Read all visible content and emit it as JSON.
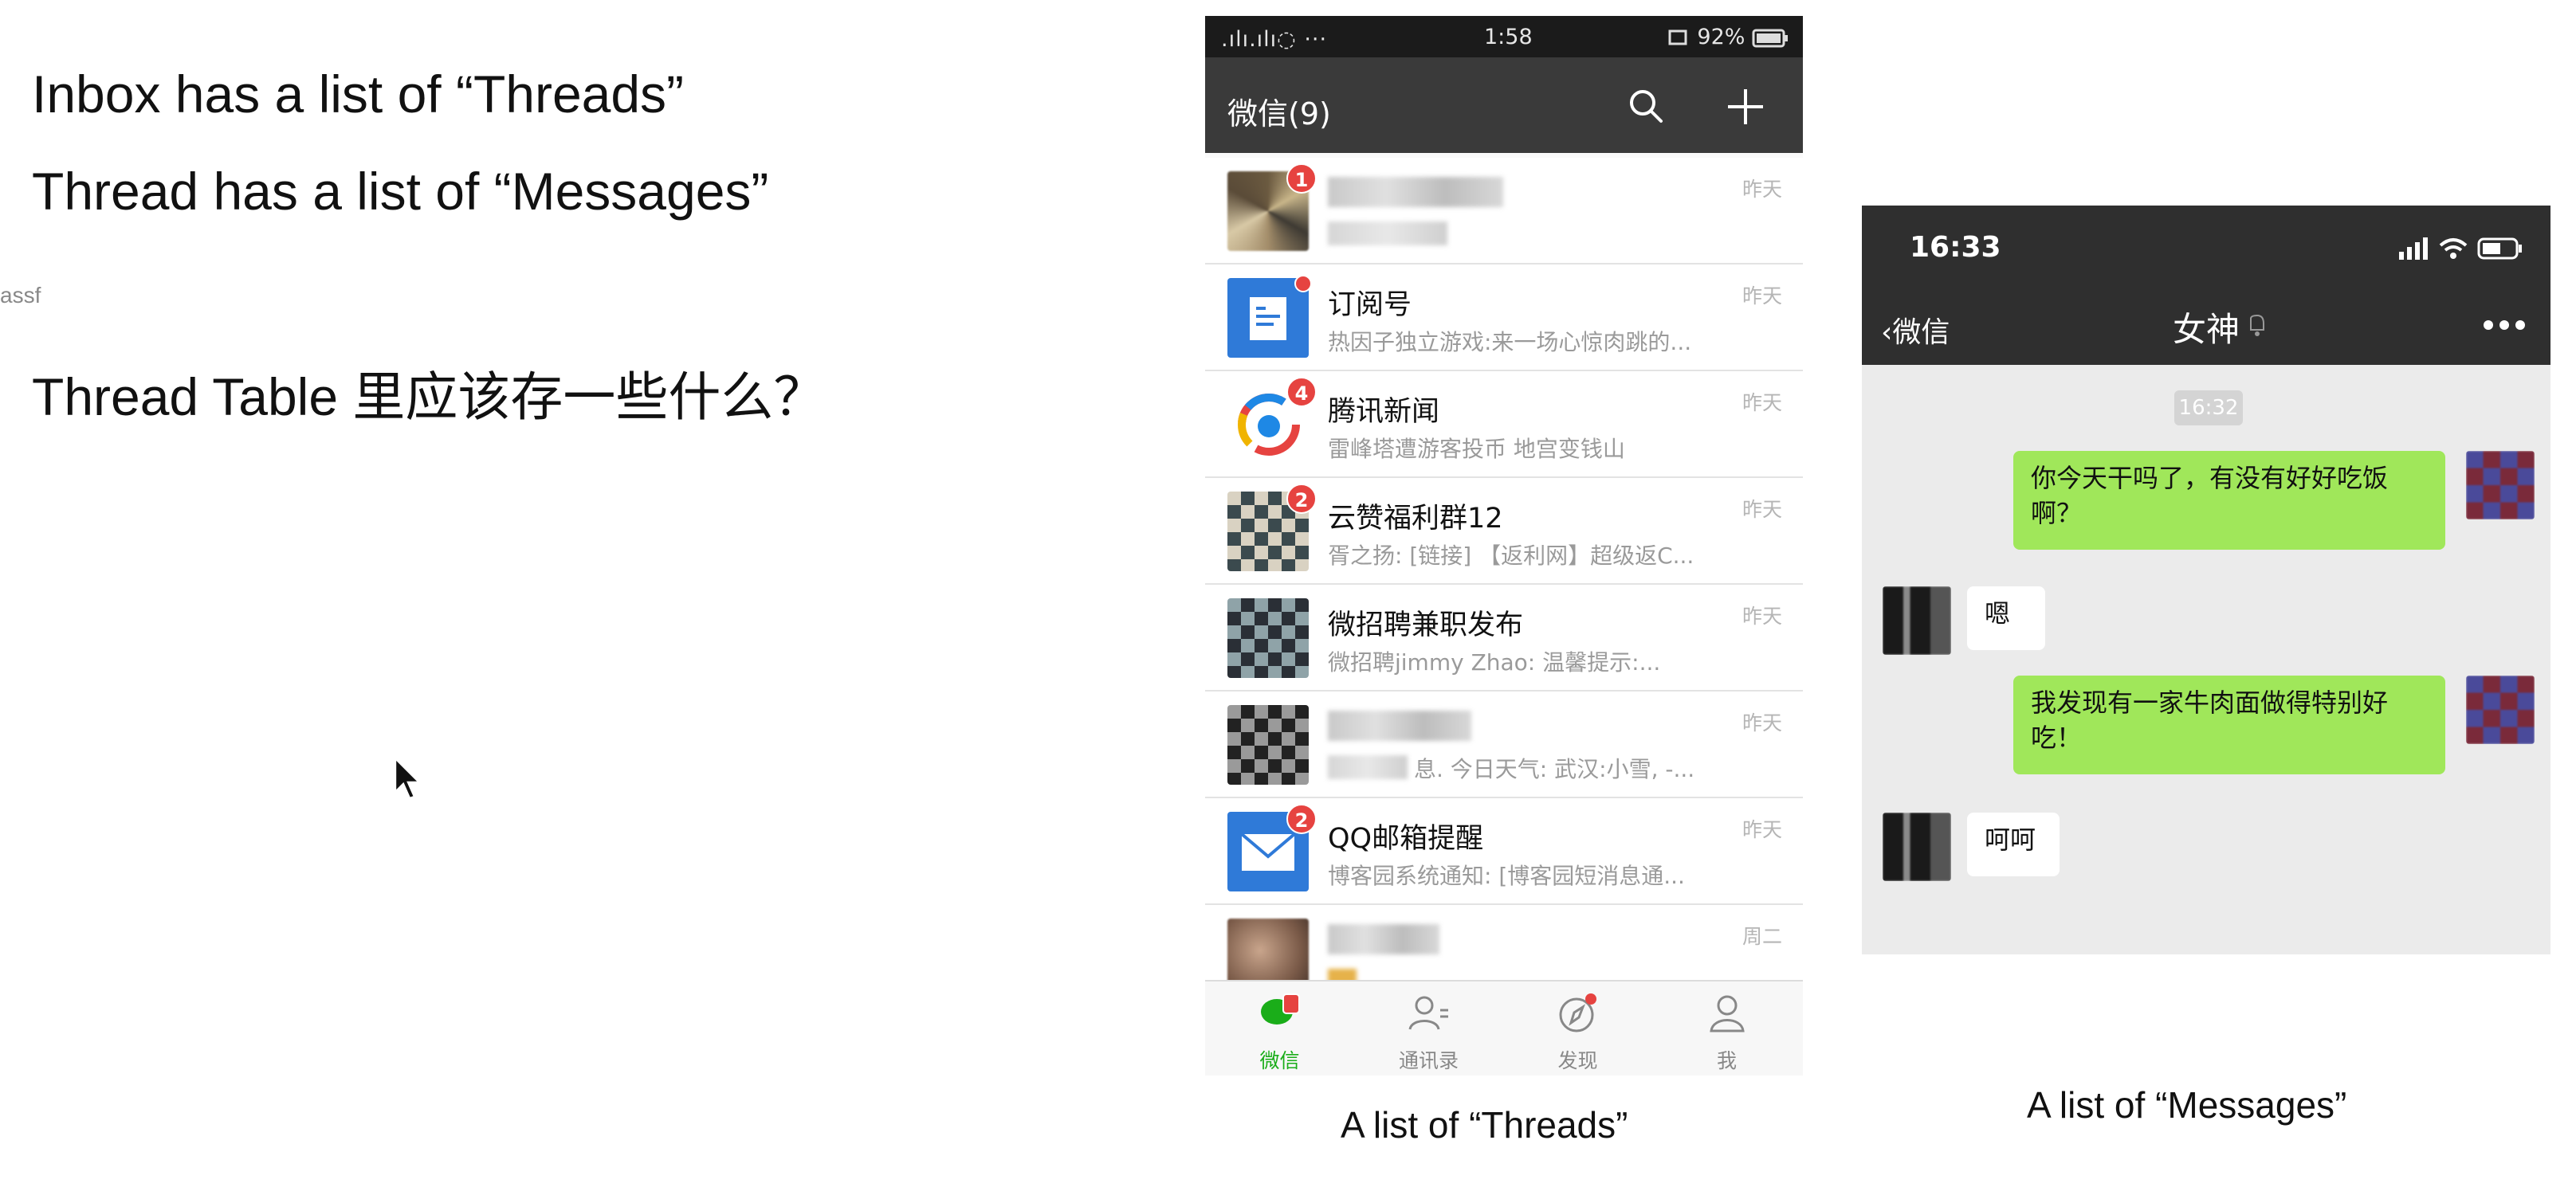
{
  "slide": {
    "line1": "Inbox has a list of “Threads”",
    "line2": "Thread has a list of “Messages”",
    "fragment": "assf",
    "line3": "Thread Table 里应该存一些什么？",
    "caption_threads": "A list of “Threads”",
    "caption_messages": "A list of “Messages”"
  },
  "thread_phone": {
    "status": {
      "signal": ".ılı.ılı◌ ···",
      "time": "1:58",
      "battery": "92%"
    },
    "header": {
      "title": "微信(9)",
      "search_icon": "search-icon",
      "add_icon": "plus-icon"
    },
    "threads": [
      {
        "name": "",
        "preview": "",
        "time": "昨天",
        "badge": "1",
        "avatar": "collage-avatar",
        "blurred": true
      },
      {
        "name": "订阅号",
        "preview": "热因子独立游戏:来一场心惊肉跳的...",
        "time": "昨天",
        "badge": "",
        "dot": true,
        "avatar": "document-icon"
      },
      {
        "name": "腾讯新闻",
        "preview": "雷峰塔遭游客投币 地宫变钱山",
        "time": "昨天",
        "badge": "4",
        "avatar": "tencent-news-logo"
      },
      {
        "name": "云赞福利群12",
        "preview": "胥之扬: [链接] 【返利网】超级返C...",
        "time": "昨天",
        "badge": "2",
        "avatar": "group-collage-avatar"
      },
      {
        "name": "微招聘兼职发布",
        "preview": "微招聘jimmy Zhao: 温馨提示:...",
        "time": "昨天",
        "badge": "",
        "avatar": "group-collage-avatar"
      },
      {
        "name": "",
        "preview": "息. 今日天气: 武汉:小雪, -...",
        "time": "昨天",
        "badge": "",
        "avatar": "group-collage-avatar",
        "blurred": true
      },
      {
        "name": "QQ邮箱提醒",
        "preview": "博客园系统通知: [博客园短消息通...",
        "time": "昨天",
        "badge": "2",
        "avatar": "mail-icon"
      },
      {
        "name": "",
        "preview": "",
        "time": "周二",
        "badge": "",
        "avatar": "photo-avatar",
        "blurred": true
      }
    ],
    "tabs": [
      {
        "label": "微信",
        "icon": "chat-icon",
        "active": true
      },
      {
        "label": "通讯录",
        "icon": "contacts-icon",
        "active": false
      },
      {
        "label": "发现",
        "icon": "compass-icon",
        "active": false
      },
      {
        "label": "我",
        "icon": "person-icon",
        "active": false
      }
    ]
  },
  "message_phone": {
    "status_time": "16:33",
    "back_label": "微信",
    "title": "女神",
    "timestamp": "16:32",
    "messages": [
      {
        "from": "me",
        "text_l1": "你今天干吗了，有没有好好吃饭",
        "text_l2": "啊？"
      },
      {
        "from": "them",
        "text_l1": "嗯",
        "text_l2": ""
      },
      {
        "from": "me",
        "text_l1": "我发现有一家牛肉面做得特别好",
        "text_l2": "吃！"
      },
      {
        "from": "them",
        "text_l1": "呵呵",
        "text_l2": ""
      }
    ]
  },
  "colors": {
    "wechat_green": "#1aad19",
    "bubble_green": "#a0e75a",
    "badge_red": "#e64340",
    "header_dark": "#3a3a3a"
  }
}
